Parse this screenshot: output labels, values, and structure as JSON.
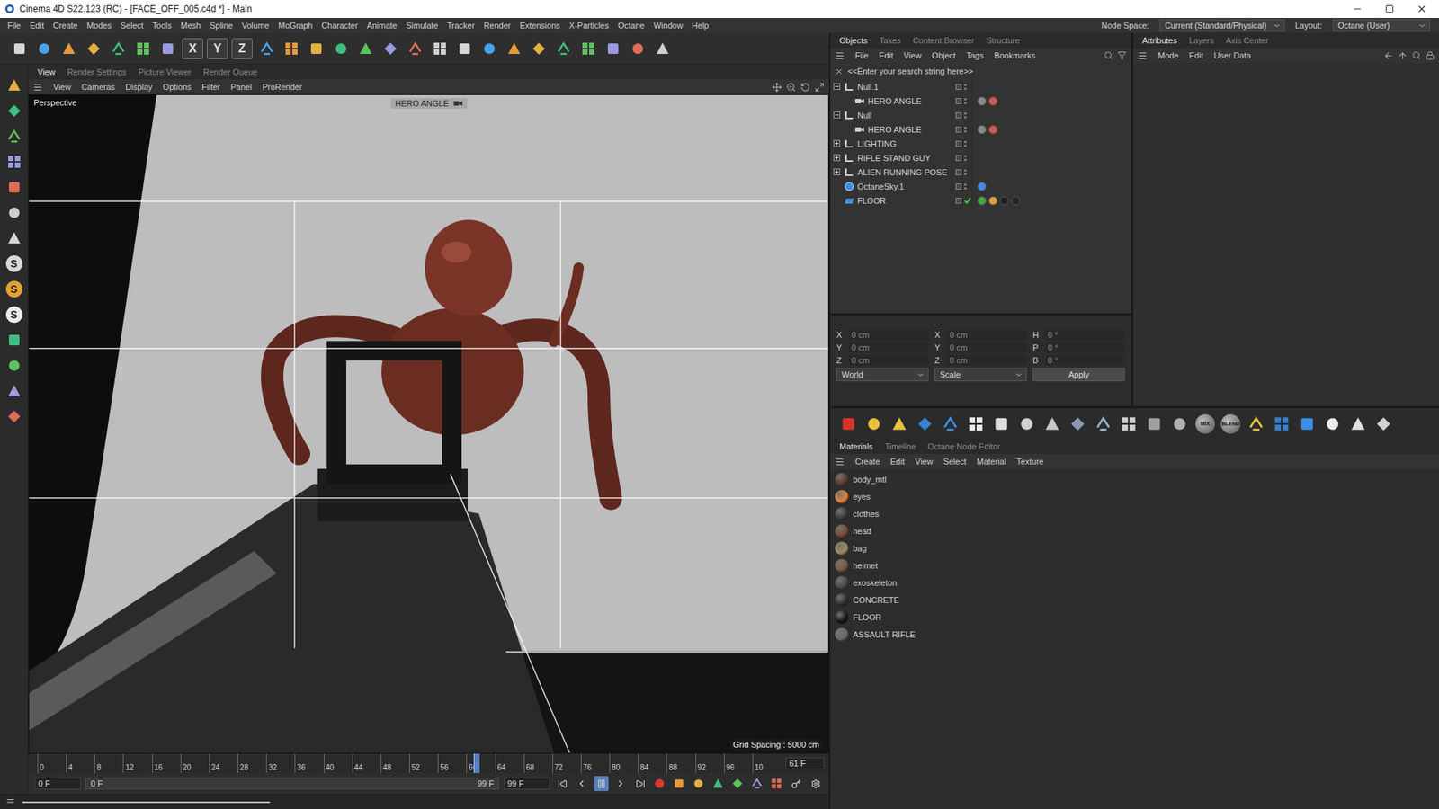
{
  "window": {
    "title": "Cinema 4D S22.123 (RC) - [FACE_OFF_005.c4d *] - Main"
  },
  "menu_bar": {
    "items": [
      "File",
      "Edit",
      "Create",
      "Modes",
      "Select",
      "Tools",
      "Mesh",
      "Spline",
      "Volume",
      "MoGraph",
      "Character",
      "Animate",
      "Simulate",
      "Tracker",
      "Render",
      "Extensions",
      "X-Particles",
      "Octane",
      "Window",
      "Help"
    ],
    "node_space_label": "Node Space:",
    "node_space_value": "Current (Standard/Physical)",
    "layout_label": "Layout:",
    "layout_value": "Octane (User)"
  },
  "toolbar": {
    "buttons": [
      {
        "kind": "icon"
      },
      {
        "kind": "icon"
      },
      {
        "kind": "icon"
      },
      {
        "kind": "icon"
      },
      {
        "kind": "icon"
      },
      {
        "kind": "icon"
      },
      {
        "kind": "icon"
      },
      {
        "kind": "axis",
        "label": "X"
      },
      {
        "kind": "axis",
        "label": "Y"
      },
      {
        "kind": "axis",
        "label": "Z"
      },
      {
        "kind": "icon"
      },
      {
        "kind": "icon"
      },
      {
        "kind": "icon"
      },
      {
        "kind": "icon"
      },
      {
        "kind": "icon"
      },
      {
        "kind": "icon"
      },
      {
        "kind": "icon"
      },
      {
        "kind": "icon"
      },
      {
        "kind": "icon"
      },
      {
        "kind": "icon"
      },
      {
        "kind": "icon"
      },
      {
        "kind": "icon"
      },
      {
        "kind": "icon"
      },
      {
        "kind": "icon"
      },
      {
        "kind": "icon"
      },
      {
        "kind": "icon"
      },
      {
        "kind": "icon"
      }
    ]
  },
  "left_toolbar": {
    "buttons": [
      {
        "kind": "icon"
      },
      {
        "kind": "icon"
      },
      {
        "kind": "icon"
      },
      {
        "kind": "icon"
      },
      {
        "kind": "icon"
      },
      {
        "kind": "icon"
      },
      {
        "kind": "icon"
      },
      {
        "kind": "badge",
        "label": "S",
        "color": "#d8d8d8"
      },
      {
        "kind": "badge",
        "label": "S",
        "color": "#e8a030"
      },
      {
        "kind": "badge",
        "label": "S",
        "color": "#ececec"
      },
      {
        "kind": "icon"
      },
      {
        "kind": "icon"
      },
      {
        "kind": "icon"
      },
      {
        "kind": "icon"
      }
    ]
  },
  "viewport_tabs": [
    {
      "label": "View",
      "selected": true
    },
    {
      "label": "Render Settings",
      "selected": false
    },
    {
      "label": "Picture Viewer",
      "selected": false
    },
    {
      "label": "Render Queue",
      "selected": false
    }
  ],
  "viewport": {
    "menu": [
      "View",
      "Cameras",
      "Display",
      "Options",
      "Filter",
      "Panel",
      "ProRender"
    ],
    "label": "Perspective",
    "camera": "HERO ANGLE",
    "grid_spacing": "Grid Spacing : 5000 cm"
  },
  "timeline": {
    "ticks": [
      "0",
      "4",
      "8",
      "12",
      "16",
      "20",
      "24",
      "28",
      "32",
      "36",
      "40",
      "44",
      "48",
      "52",
      "56",
      "60",
      "64",
      "68",
      "72",
      "76",
      "80",
      "84",
      "88",
      "92",
      "96",
      "10"
    ],
    "current_frame": "61 F",
    "playhead": 0.61,
    "start": "0 F",
    "preview_start": "0 F",
    "preview_end": "99 F",
    "end": "99 F",
    "playing": true
  },
  "objects_panel": {
    "tabs": [
      {
        "label": "Objects",
        "selected": true
      },
      {
        "label": "Takes",
        "selected": false
      },
      {
        "label": "Content Browser",
        "selected": false
      },
      {
        "label": "Structure",
        "selected": false
      }
    ],
    "menu": [
      "File",
      "Edit",
      "View",
      "Object",
      "Tags",
      "Bookmarks"
    ],
    "search_placeholder": "<<Enter your search string here>>",
    "objects": [
      {
        "name": "Null.1",
        "depth": 0,
        "kind": "null",
        "has_children": true,
        "expanded": true,
        "checked": false,
        "tags": []
      },
      {
        "name": "HERO ANGLE",
        "depth": 1,
        "kind": "camera",
        "has_children": false,
        "expanded": false,
        "checked": false,
        "tags": [
          {
            "color": "#8a8a8a"
          },
          {
            "color": "#d9534f"
          }
        ]
      },
      {
        "name": "Null",
        "depth": 0,
        "kind": "null",
        "has_children": true,
        "expanded": true,
        "checked": false,
        "tags": []
      },
      {
        "name": "HERO ANGLE",
        "depth": 1,
        "kind": "camera",
        "has_children": false,
        "expanded": false,
        "checked": false,
        "tags": [
          {
            "color": "#8a8a8a"
          },
          {
            "color": "#d9534f"
          }
        ]
      },
      {
        "name": "LIGHTING",
        "depth": 0,
        "kind": "null",
        "has_children": true,
        "expanded": false,
        "checked": false,
        "tags": []
      },
      {
        "name": "RIFLE STAND GUY",
        "depth": 0,
        "kind": "null",
        "has_children": true,
        "expanded": false,
        "checked": false,
        "tags": []
      },
      {
        "name": "ALIEN RUNNING POSE",
        "depth": 0,
        "kind": "null",
        "has_children": true,
        "expanded": false,
        "checked": false,
        "tags": []
      },
      {
        "name": "OctaneSky.1",
        "depth": 0,
        "kind": "sky",
        "has_children": false,
        "expanded": false,
        "checked": false,
        "tags": [
          {
            "color": "#3a8ee6"
          }
        ]
      },
      {
        "name": "FLOOR",
        "depth": 0,
        "kind": "floor",
        "has_children": false,
        "expanded": false,
        "checked": true,
        "tags": [
          {
            "color": "#3caa3c"
          },
          {
            "color": "#e0a030"
          },
          {
            "color": "#222222"
          },
          {
            "color": "#222222"
          }
        ]
      }
    ]
  },
  "coordinates": {
    "header": [
      "--",
      "--"
    ],
    "rows": [
      {
        "position_axis": "X",
        "position": "0 cm",
        "size_axis": "X",
        "size": "0 cm",
        "rotation_axis": "H",
        "rotation": "0 °"
      },
      {
        "position_axis": "Y",
        "position": "0 cm",
        "size_axis": "Y",
        "size": "0 cm",
        "rotation_axis": "P",
        "rotation": "0 °"
      },
      {
        "position_axis": "Z",
        "position": "0 cm",
        "size_axis": "Z",
        "size": "0 cm",
        "rotation_axis": "B",
        "rotation": "0 °"
      }
    ],
    "space": "World",
    "mode": "Scale",
    "apply": "Apply"
  },
  "octane_toolbar": {
    "buttons": [
      {
        "kind": "icon"
      },
      {
        "kind": "icon"
      },
      {
        "kind": "icon"
      },
      {
        "kind": "icon"
      },
      {
        "kind": "icon"
      },
      {
        "kind": "icon"
      },
      {
        "kind": "icon"
      },
      {
        "kind": "icon"
      },
      {
        "kind": "icon"
      },
      {
        "kind": "icon"
      },
      {
        "kind": "icon"
      },
      {
        "kind": "icon"
      },
      {
        "kind": "icon"
      },
      {
        "kind": "icon"
      },
      {
        "kind": "labeled",
        "label": "MIX"
      },
      {
        "kind": "labeled",
        "label": "BLEND"
      },
      {
        "kind": "icon"
      },
      {
        "kind": "icon"
      },
      {
        "kind": "icon"
      },
      {
        "kind": "icon"
      },
      {
        "kind": "icon"
      },
      {
        "kind": "icon"
      }
    ]
  },
  "materials_panel": {
    "tabs": [
      {
        "label": "Materials",
        "selected": true
      },
      {
        "label": "Timeline",
        "selected": false
      },
      {
        "label": "Octane Node Editor",
        "selected": false
      }
    ],
    "menu": [
      "Create",
      "Edit",
      "View",
      "Select",
      "Material",
      "Texture"
    ],
    "materials": [
      {
        "name": "body_mtl",
        "color": "#5a3a33"
      },
      {
        "name": "eyes",
        "color": "#e8813a"
      },
      {
        "name": "clothes",
        "color": "#3a3a3a"
      },
      {
        "name": "head",
        "color": "#7a4a38"
      },
      {
        "name": "bag",
        "color": "#a08a60"
      },
      {
        "name": "helmet",
        "color": "#7a5a40"
      },
      {
        "name": "exoskeleton",
        "color": "#4a4a4a"
      },
      {
        "name": "CONCRETE",
        "color": "#2e2e2e"
      },
      {
        "name": "FLOOR",
        "color": "#151515"
      },
      {
        "name": "ASSAULT RIFLE",
        "color": "#6a6a6a"
      }
    ]
  },
  "attributes_panel": {
    "tabs": [
      {
        "label": "Attributes",
        "selected": true
      },
      {
        "label": "Layers",
        "selected": false
      },
      {
        "label": "Axis Center",
        "selected": false
      }
    ],
    "menu": [
      "Mode",
      "Edit",
      "User Data"
    ]
  }
}
